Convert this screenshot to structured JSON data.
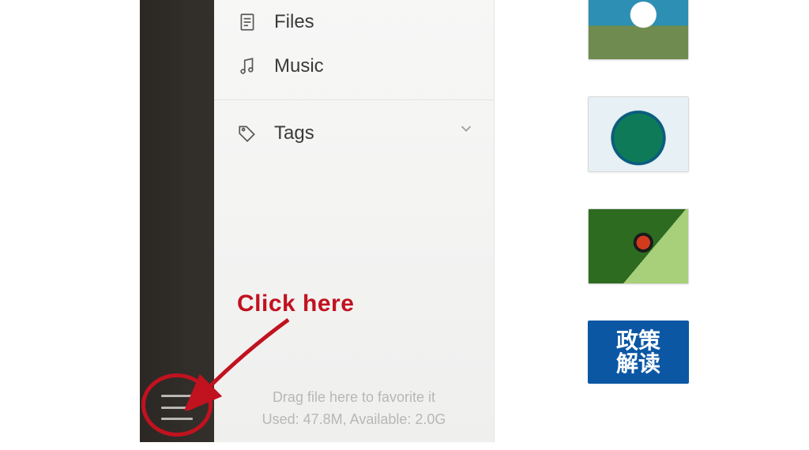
{
  "sidebar": {
    "items": [
      {
        "label": "Files",
        "icon": "file-icon"
      },
      {
        "label": "Music",
        "icon": "music-icon"
      }
    ],
    "sections": [
      {
        "label": "Tags",
        "icon": "tag-icon",
        "expanded": false
      }
    ]
  },
  "footer": {
    "hint": "Drag file here to favorite it",
    "storage": "Used: 47.8M, Available: 2.0G"
  },
  "annotation": {
    "label": "Click here",
    "color": "#c1121f"
  },
  "thumbnails": [
    {
      "name": "thumbnail-1",
      "alt": "bird photo"
    },
    {
      "name": "thumbnail-2",
      "alt": "island map"
    },
    {
      "name": "thumbnail-3",
      "alt": "bird on branch"
    },
    {
      "name": "thumbnail-4",
      "alt": "policy tile",
      "text": "政策\n解读"
    }
  ]
}
